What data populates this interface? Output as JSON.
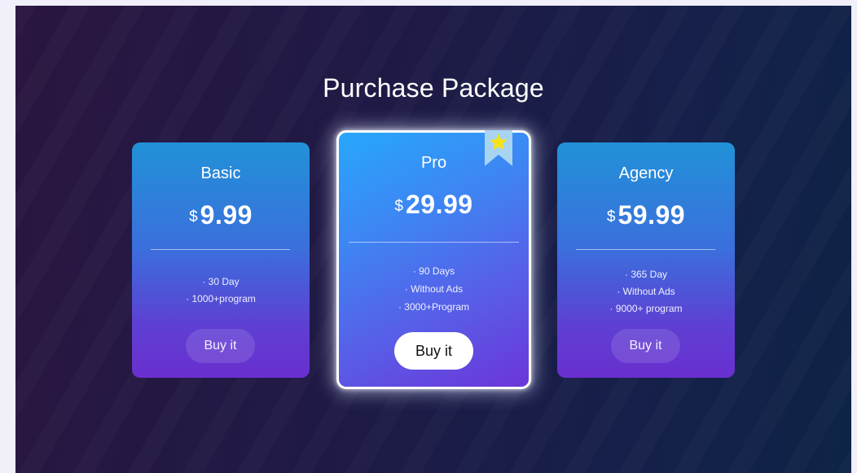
{
  "page": {
    "title": "Purchase Package"
  },
  "colors": {
    "background_start": "#2a1640",
    "background_end": "#0e2446",
    "card_top": "#2192d8",
    "card_bottom": "#6a2fcf",
    "pro_border": "#ffffff",
    "ribbon": "#a8d4f2",
    "star": "#f6e21a"
  },
  "plans": [
    {
      "name": "Basic",
      "currency": "$",
      "price": "9.99",
      "features": [
        "· 30 Day",
        "· 1000+program"
      ],
      "button": "Buy it"
    },
    {
      "name": "Pro",
      "currency": "$",
      "price": "29.99",
      "features": [
        "· 90 Days",
        "· Without Ads",
        "· 3000+Program"
      ],
      "button": "Buy it",
      "badge_icon": "star-bookmark-icon"
    },
    {
      "name": "Agency",
      "currency": "$",
      "price": "59.99",
      "features": [
        "· 365 Day",
        "· Without Ads",
        "· 9000+ program"
      ],
      "button": "Buy it"
    }
  ]
}
